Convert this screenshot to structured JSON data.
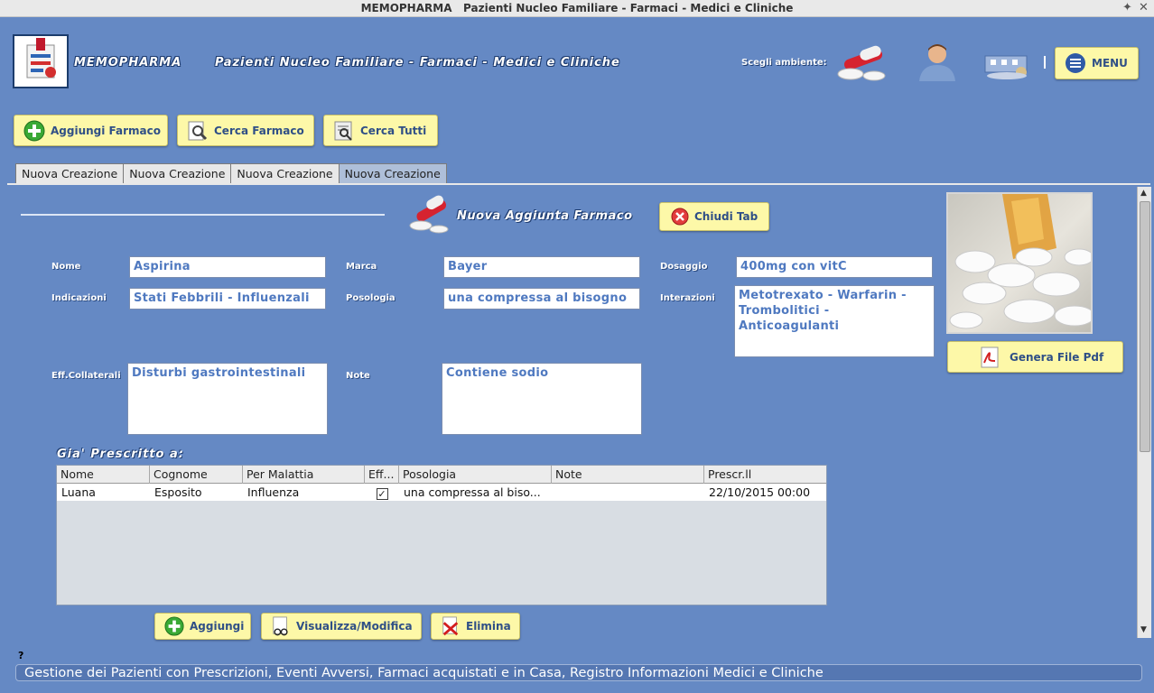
{
  "window": {
    "title_app": "MEMOPHARMA",
    "title_rest": "Pazienti Nucleo Familiare - Farmaci - Medici e Cliniche"
  },
  "header": {
    "brand": "MEMOPHARMA",
    "subtitle": "Pazienti Nucleo Familiare - Farmaci - Medici e Cliniche",
    "env_label": "Scegli ambiente:",
    "menu_label": "MENU",
    "env_icons": [
      "pills-icon",
      "patient-icon",
      "clinic-icon"
    ]
  },
  "toolbar": {
    "add_label": "Aggiungi Farmaco",
    "search_label": "Cerca Farmaco",
    "search_all_label": "Cerca Tutti"
  },
  "tabs": [
    "Nuova Creazione",
    "Nuova Creazione",
    "Nuova Creazione",
    "Nuova Creazione"
  ],
  "form": {
    "title": "Nuova Aggiunta Farmaco",
    "close_label": "Chiudi Tab",
    "pdf_label": "Genera File Pdf",
    "labels": {
      "nome": "Nome",
      "marca": "Marca",
      "dosaggio": "Dosaggio",
      "indicazioni": "Indicazioni",
      "posologia": "Posologia",
      "interazioni": "Interazioni",
      "eff_collaterali": "Eff.Collaterali",
      "note": "Note"
    },
    "values": {
      "nome": "Aspirina",
      "marca": "Bayer",
      "dosaggio": "400mg con vitC",
      "indicazioni": "Stati Febbrili - Influenzali",
      "posologia": "una compressa al bisogno",
      "interazioni": "Metotrexato - Warfarin - Trombolitici - Anticoagulanti",
      "eff_collaterali": "Disturbi gastrointestinali",
      "note": "Contiene sodio"
    }
  },
  "prescriptions": {
    "title": "Gia' Prescritto a:",
    "columns": [
      "Nome",
      "Cognome",
      "Per Malattia",
      "Eff...",
      "Posologia",
      "Note",
      "Prescr.ll"
    ],
    "rows": [
      {
        "nome": "Luana",
        "cognome": "Esposito",
        "malattia": "Influenza",
        "eff": true,
        "posologia": "una compressa al biso...",
        "note": "",
        "prescr": "22/10/2015 00:00"
      }
    ],
    "add_label": "Aggiungi",
    "view_label": "Visualizza/Modifica",
    "delete_label": "Elimina"
  },
  "footer": {
    "help": "?",
    "status": "Gestione dei Pazienti con Prescrizioni, Eventi Avversi, Farmaci acquistati e in Casa, Registro Informazioni Medici e Cliniche"
  },
  "colors": {
    "background": "#6589c4",
    "button": "#fdf8a8",
    "button_text": "#2f4f86",
    "field_text": "#4f79c0"
  }
}
